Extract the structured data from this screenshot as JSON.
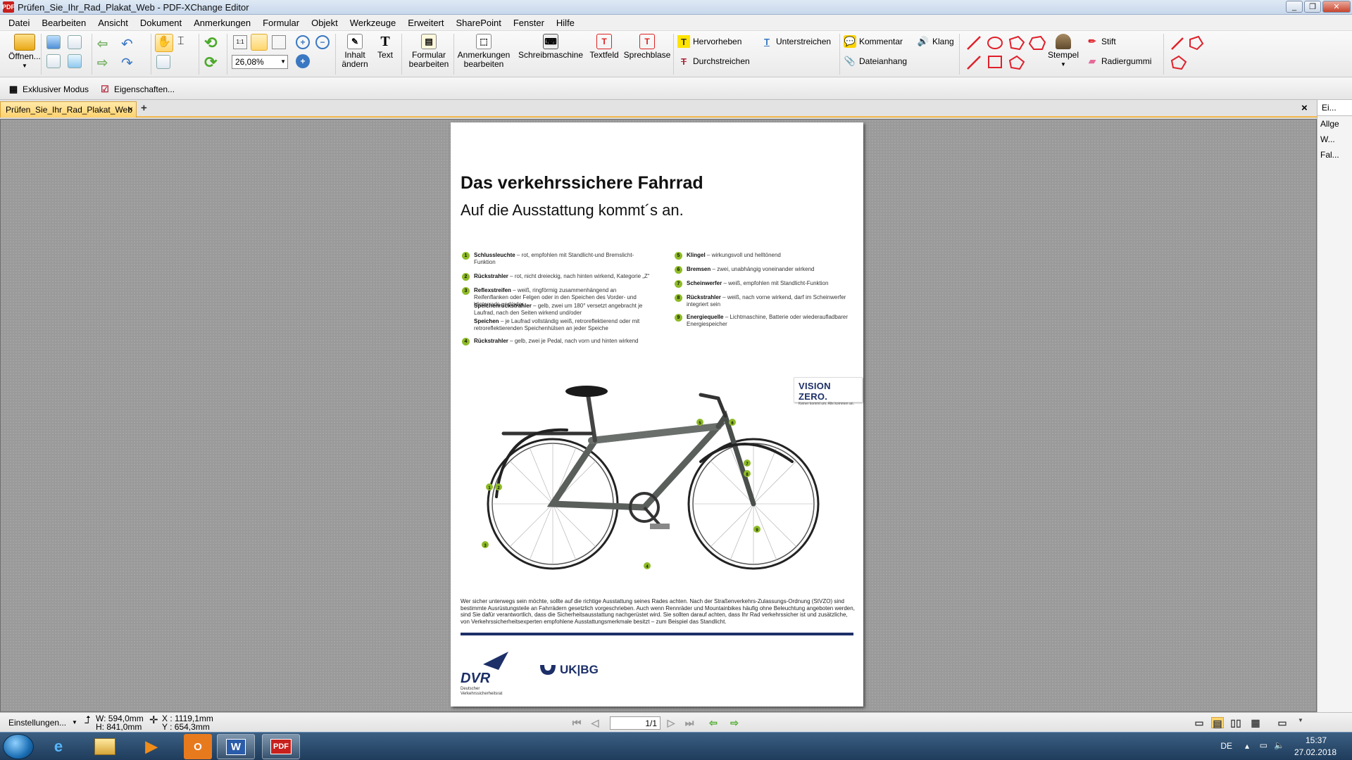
{
  "window": {
    "title": "Prüfen_Sie_Ihr_Rad_Plakat_Web - PDF-XChange Editor",
    "app_logo": "PDF"
  },
  "menu": [
    "Datei",
    "Bearbeiten",
    "Ansicht",
    "Dokument",
    "Anmerkungen",
    "Formular",
    "Objekt",
    "Werkzeuge",
    "Erweitert",
    "SharePoint",
    "Fenster",
    "Hilfe"
  ],
  "ribbon": {
    "open": "Öffnen...",
    "zoom": "26,08%",
    "zoom_dropdown_icon": "chevron-down-icon",
    "edit_content_1": "Inhalt",
    "edit_content_2": "ändern",
    "text": "Text",
    "form_edit_1": "Formular",
    "form_edit_2": "bearbeiten",
    "annot_edit_1": "Anmerkungen",
    "annot_edit_2": "bearbeiten",
    "typewriter": "Schreibmaschine",
    "textfield": "Textfeld",
    "callout": "Sprechblase",
    "highlight": "Hervorheben",
    "underline": "Unterstreichen",
    "strikeout": "Durchstreichen",
    "comment": "Kommentar",
    "attachment": "Dateianhang",
    "sound": "Klang",
    "stamp": "Stempel",
    "pencil": "Stift",
    "eraser": "Radiergummi"
  },
  "toolbar2": {
    "exclusive": "Exklusiver Modus",
    "properties": "Eigenschaften..."
  },
  "tabs": {
    "doc_tab": "Prüfen_Sie_Ihr_Rad_Plakat_Web",
    "close": "×",
    "new_tab": "+",
    "close_all": "×"
  },
  "right_panel": {
    "header": "Ei...",
    "items": [
      "Allge",
      "W...",
      "Fal..."
    ]
  },
  "poster": {
    "title": "Das verkehrssichere Fahrrad",
    "subtitle": "Auf die Ausstattung kommt´s an.",
    "features_left": [
      {
        "num": "1",
        "name": "Schlussleuchte",
        "desc": "– rot, empfohlen mit Standlicht-und Bremslicht-Funktion"
      },
      {
        "num": "2",
        "name": "Rückstrahler",
        "desc": "– rot, nicht dreieckig, nach hinten wirkend, Kategorie „Z“"
      },
      {
        "num": "3",
        "name": "Reflexstreifen",
        "desc": "– weiß, ringförmig zusammenhängend an Reifenflanken oder Felgen oder in den Speichen des Vorder- und Hinterrads und/oder"
      },
      {
        "num": "",
        "name": "Speichenrückstrahler",
        "desc": "– gelb, zwei um 180° versetzt angebracht je Laufrad, nach den Seiten wirkend und/oder"
      },
      {
        "num": "",
        "name": "Speichen",
        "desc": "– je Laufrad vollständig weiß, retroreflektierend oder mit retroreflektierenden Speichenhülsen an jeder Speiche"
      },
      {
        "num": "4",
        "name": "Rückstrahler",
        "desc": "– gelb, zwei je Pedal, nach vorn und hinten wirkend"
      }
    ],
    "features_right": [
      {
        "num": "5",
        "name": "Klingel",
        "desc": "– wirkungsvoll und helltönend"
      },
      {
        "num": "6",
        "name": "Bremsen",
        "desc": "– zwei, unabhängig voneinander wirkend"
      },
      {
        "num": "7",
        "name": "Scheinwerfer",
        "desc": "– weiß, empfohlen mit Standlicht-Funktion"
      },
      {
        "num": "8",
        "name": "Rückstrahler",
        "desc": "– weiß, nach vorne wirkend, darf im Scheinwerfer integriert sein"
      },
      {
        "num": "9",
        "name": "Energiequelle",
        "desc": "– Lichtmaschine, Batterie oder wiederaufladbarer Energiespeicher"
      }
    ],
    "vision_zero": "VISION ZERO.",
    "vision_zero_sub": "Keiner kommt um. Alle kommen an.",
    "bike_labels": [
      "1",
      "2",
      "3",
      "4",
      "5",
      "6",
      "7",
      "8",
      "9"
    ],
    "description": "Wer sicher unterwegs sein möchte, sollte auf die richtige Ausstattung seines Rades achten. Nach der Straßenverkehrs-Zulassungs-Ordnung (StVZO) sind bestimmte Ausrüstungsteile an Fahrrädern gesetzlich vorgeschrieben. Auch wenn Rennräder und Mountainbikes häufig ohne Beleuchtung angeboten werden, sind Sie dafür verantwortlich, dass die Sicherheitsausstattung nachgerüstet wird. Sie sollten darauf achten, dass Ihr Rad verkehrssicher ist und zusätzliche, von Verkehrssicherheitsexperten empfohlene Ausstattungsmerkmale besitzt – zum Beispiel das Standlicht.",
    "dvr_logo": "DVR",
    "dvr_text": "Deutscher Verkehrssicherheitsrat",
    "ukbg": "UK|BG"
  },
  "status": {
    "settings": "Einstellungen...",
    "width": "W: 594,0mm",
    "height": "H: 841,0mm",
    "x": "X : 1119,1mm",
    "y": "Y : 654,3mm",
    "page": "1/1"
  },
  "tray": {
    "lang": "DE",
    "time": "15:37",
    "date": "27.02.2018"
  },
  "colors": {
    "accent_green": "#8dbb26",
    "navy": "#1c2f68",
    "tab_orange": "#ffd26e",
    "annot_red": "#e0202a"
  }
}
